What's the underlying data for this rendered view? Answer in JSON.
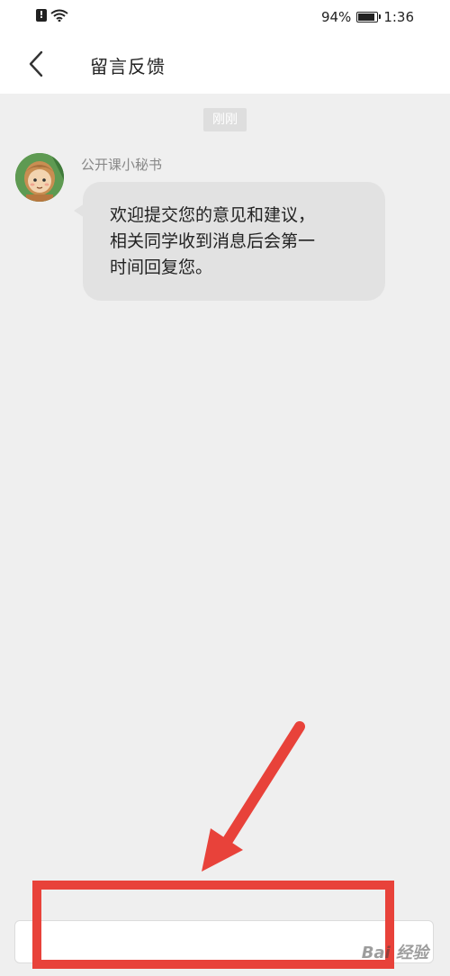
{
  "status_bar": {
    "battery": "94%",
    "time": "1:36",
    "icons": [
      "alert-icon",
      "wifi-icon",
      "battery-icon"
    ]
  },
  "header": {
    "title": "留言反馈",
    "back_icon": "back-chevron-icon"
  },
  "chat": {
    "timestamp": "刚刚",
    "messages": [
      {
        "sender": "公开课小秘书",
        "avatar_icon": "avatar-icon",
        "lines": [
          "欢迎提交您的意见和建议，",
          "相关同学收到消息后会第一",
          "时间回复您。"
        ]
      }
    ]
  },
  "input_bar": {
    "value": "",
    "placeholder": ""
  },
  "annotation": {
    "color": "#e8423a",
    "shapes": [
      "arrow",
      "highlight-box"
    ]
  },
  "watermark": {
    "text": "Bai 经验"
  }
}
